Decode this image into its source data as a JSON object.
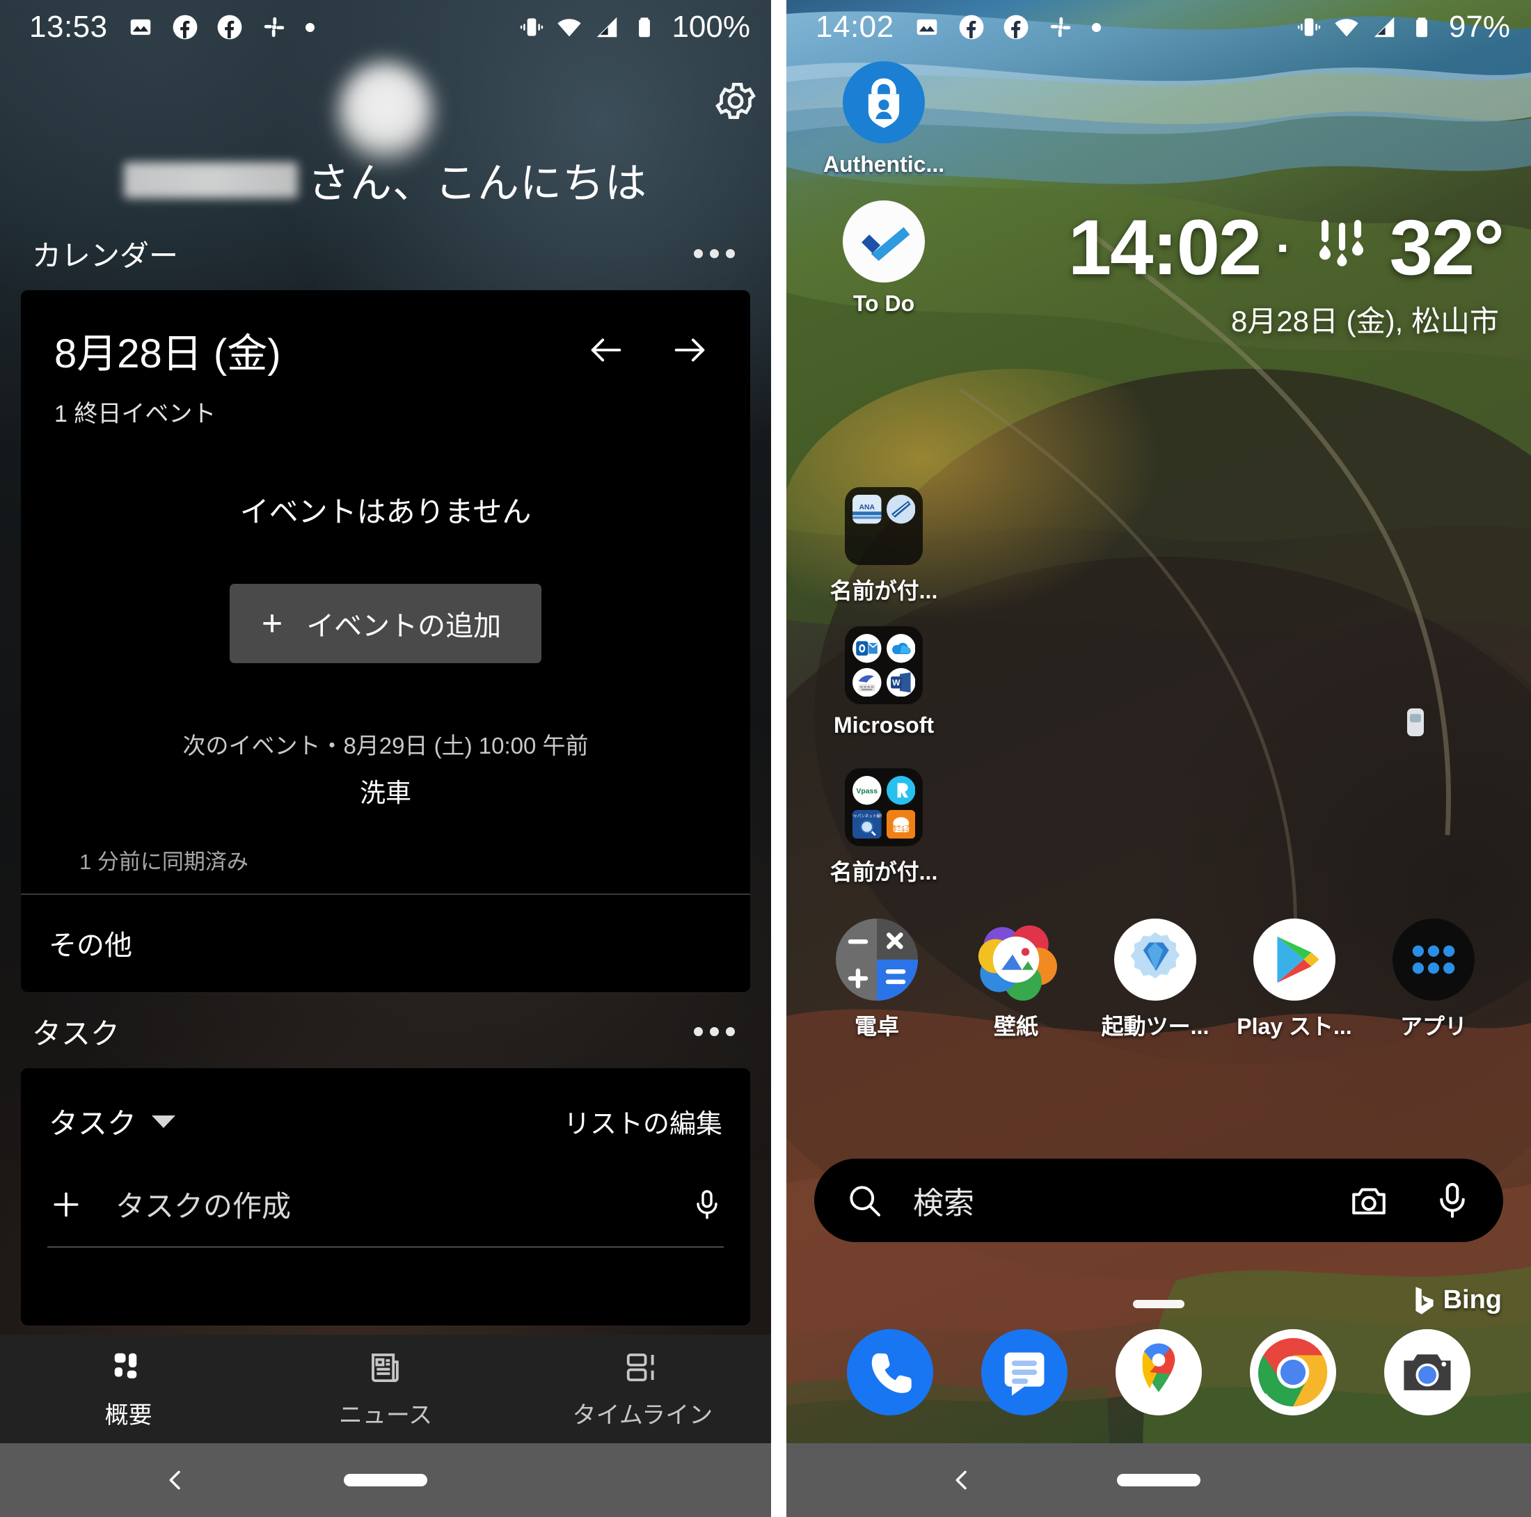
{
  "left_phone": {
    "status_bar": {
      "time": "13:53",
      "battery_text": "100%",
      "icons": [
        "photos-icon",
        "facebook-icon",
        "facebook-icon",
        "slack-icon",
        "dot-icon"
      ],
      "right_icons": [
        "vibrate-icon",
        "wifi-icon",
        "cellular-signal-icon",
        "battery-icon"
      ]
    },
    "header": {
      "greeting": "さん、こんにちは",
      "name_redacted": "",
      "settings_icon": "gear-icon",
      "avatar": "avatar"
    },
    "calendar_section": {
      "title": "カレンダー",
      "overflow_icon": "more-options-icon",
      "date": "8月28日 (金)",
      "all_day_count": "1 終日イベント",
      "prev_icon": "arrow-left-icon",
      "next_icon": "arrow-right-icon",
      "empty_message": "イベントはありません",
      "add_event_label": "イベントの追加",
      "next_event_line": "次のイベント・8月29日 (土) 10:00 午前",
      "next_event_title": "洗車",
      "sync_status": "1 分前に同期済み",
      "other_label": "その他"
    },
    "tasks_section": {
      "title": "タスク",
      "overflow_icon": "more-options-icon",
      "list_selector": "タスク",
      "edit_list_label": "リストの編集",
      "create_placeholder": "タスクの作成",
      "mic_icon": "microphone-icon",
      "add_icon": "plus-icon"
    },
    "bottom_nav": [
      {
        "label": "概要",
        "icon": "dashboard-icon",
        "active": true
      },
      {
        "label": "ニュース",
        "icon": "news-icon",
        "active": false
      },
      {
        "label": "タイムライン",
        "icon": "timeline-icon",
        "active": false
      }
    ],
    "system_nav": {
      "back_icon": "back-chevron-icon",
      "home_icon": "home-pill-icon"
    }
  },
  "right_phone": {
    "status_bar": {
      "time": "14:02",
      "battery_text": "97%",
      "icons": [
        "photos-icon",
        "facebook-icon",
        "facebook-icon",
        "slack-icon",
        "dot-icon"
      ],
      "right_icons": [
        "vibrate-icon",
        "wifi-icon",
        "cellular-signal-icon",
        "battery-icon"
      ]
    },
    "widget": {
      "time": "14:02",
      "separator": "·",
      "weather_icon": "rain-drops-icon",
      "temperature": "32°",
      "date_location": "8月28日 (金), 松山市"
    },
    "home_icons": [
      {
        "label": "Authentic...",
        "icon": "microsoft-authenticator-icon",
        "type": "app"
      },
      {
        "label": "To Do",
        "icon": "microsoft-todo-icon",
        "type": "app"
      },
      {
        "label": "名前が付...",
        "icon": "folder-ana-icon",
        "type": "folder"
      },
      {
        "label": "Microsoft",
        "icon": "folder-microsoft-icon",
        "type": "folder"
      },
      {
        "label": "名前が付...",
        "icon": "folder-payment-icon",
        "type": "folder"
      }
    ],
    "app_row": [
      {
        "label": "電卓",
        "icon": "calculator-icon"
      },
      {
        "label": "壁紙",
        "icon": "wallpapers-icon"
      },
      {
        "label": "起動ツー...",
        "icon": "launch-tool-icon"
      },
      {
        "label": "Play スト...",
        "icon": "play-store-icon"
      },
      {
        "label": "アプリ",
        "icon": "app-drawer-icon"
      }
    ],
    "search": {
      "placeholder": "検索",
      "search_icon": "search-icon",
      "camera_icon": "camera-icon",
      "mic_icon": "microphone-icon",
      "brand": "Bing",
      "brand_icon": "bing-icon"
    },
    "dock": [
      {
        "icon": "phone-icon"
      },
      {
        "icon": "messages-icon"
      },
      {
        "icon": "google-maps-icon"
      },
      {
        "icon": "chrome-icon"
      },
      {
        "icon": "camera-app-icon"
      }
    ],
    "system_nav": {
      "back_icon": "back-chevron-icon",
      "home_icon": "home-pill-icon"
    }
  },
  "colors": {
    "accent_blue": "#0078d4",
    "card_bg": "#000000",
    "nav_bg": "#222222",
    "sysnav_bg": "#5a5a5a",
    "button_bg": "#4a4a4a"
  }
}
